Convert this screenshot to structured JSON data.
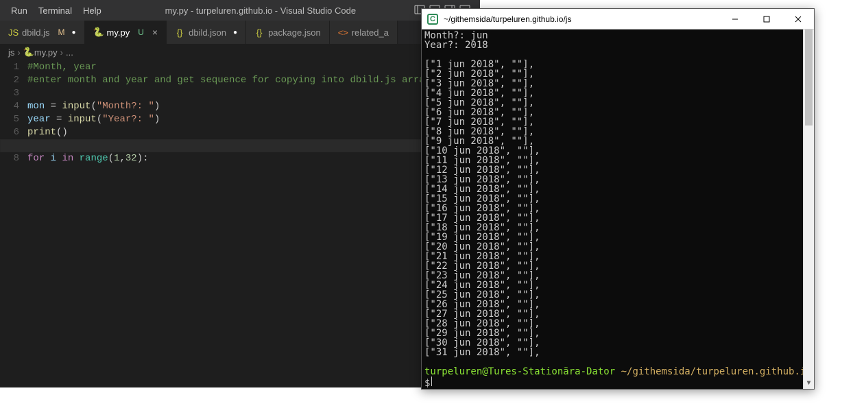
{
  "vscode": {
    "menu": {
      "run": "Run",
      "terminal": "Terminal",
      "help": "Help"
    },
    "window_title": "my.py - turpeluren.github.io - Visual Studio Code",
    "tabs": [
      {
        "icon": "JS",
        "icon_color": "#cbcb41",
        "label": "dbild.js",
        "status": "M",
        "modified": true,
        "active": false
      },
      {
        "icon": "🐍",
        "icon_color": "#3572A5",
        "label": "my.py",
        "status": "U",
        "modified": false,
        "active": true
      },
      {
        "icon": "{}",
        "icon_color": "#cbcb41",
        "label": "dbild.json",
        "status": "",
        "modified": true,
        "active": false
      },
      {
        "icon": "{}",
        "icon_color": "#cbcb41",
        "label": "package.json",
        "status": "",
        "modified": false,
        "active": false
      },
      {
        "icon": "<>",
        "icon_color": "#e37933",
        "label": "related_a",
        "status": "",
        "modified": false,
        "active": false
      }
    ],
    "breadcrumb": {
      "root": "js",
      "file": "my.py",
      "more": "..."
    },
    "code_lines": [
      {
        "n": 1,
        "segs": [
          {
            "t": "#Month, year",
            "c": "c-comment"
          }
        ]
      },
      {
        "n": 2,
        "segs": [
          {
            "t": "#enter month and year and get sequence for copying into dbild.js array",
            "c": "c-comment"
          }
        ]
      },
      {
        "n": 3,
        "segs": []
      },
      {
        "n": 4,
        "segs": [
          {
            "t": "mon",
            "c": "c-var"
          },
          {
            "t": " = ",
            "c": "c-punc"
          },
          {
            "t": "input",
            "c": "c-func"
          },
          {
            "t": "(",
            "c": "c-punc"
          },
          {
            "t": "\"Month?: \"",
            "c": "c-str"
          },
          {
            "t": ")",
            "c": "c-punc"
          }
        ]
      },
      {
        "n": 5,
        "segs": [
          {
            "t": "year",
            "c": "c-var"
          },
          {
            "t": " = ",
            "c": "c-punc"
          },
          {
            "t": "input",
            "c": "c-func"
          },
          {
            "t": "(",
            "c": "c-punc"
          },
          {
            "t": "\"Year?: \"",
            "c": "c-str"
          },
          {
            "t": ")",
            "c": "c-punc"
          }
        ]
      },
      {
        "n": 6,
        "segs": [
          {
            "t": "print",
            "c": "c-func"
          },
          {
            "t": "()",
            "c": "c-punc"
          }
        ]
      },
      {
        "n": 7,
        "segs": [],
        "cursor": true
      },
      {
        "n": 8,
        "segs": [
          {
            "t": "for",
            "c": "c-kw"
          },
          {
            "t": " ",
            "c": "c-punc"
          },
          {
            "t": "i",
            "c": "c-var"
          },
          {
            "t": " ",
            "c": "c-punc"
          },
          {
            "t": "in",
            "c": "c-kw"
          },
          {
            "t": " ",
            "c": "c-punc"
          },
          {
            "t": "range",
            "c": "c-builtin"
          },
          {
            "t": "(",
            "c": "c-punc"
          },
          {
            "t": "1",
            "c": "c-num"
          },
          {
            "t": ",",
            "c": "c-punc"
          },
          {
            "t": "32",
            "c": "c-num"
          },
          {
            "t": "):",
            "c": "c-punc"
          }
        ]
      }
    ]
  },
  "cmd": {
    "title": "~/githemsida/turpeluren.github.io/js",
    "input_lines": [
      "Month?: jun",
      "Year?: 2018",
      ""
    ],
    "output": [
      "[\"1 jun 2018\", \"\"],",
      "[\"2 jun 2018\", \"\"],",
      "[\"3 jun 2018\", \"\"],",
      "[\"4 jun 2018\", \"\"],",
      "[\"5 jun 2018\", \"\"],",
      "[\"6 jun 2018\", \"\"],",
      "[\"7 jun 2018\", \"\"],",
      "[\"8 jun 2018\", \"\"],",
      "[\"9 jun 2018\", \"\"],",
      "[\"10 jun 2018\", \"\"],",
      "[\"11 jun 2018\", \"\"],",
      "[\"12 jun 2018\", \"\"],",
      "[\"13 jun 2018\", \"\"],",
      "[\"14 jun 2018\", \"\"],",
      "[\"15 jun 2018\", \"\"],",
      "[\"16 jun 2018\", \"\"],",
      "[\"17 jun 2018\", \"\"],",
      "[\"18 jun 2018\", \"\"],",
      "[\"19 jun 2018\", \"\"],",
      "[\"20 jun 2018\", \"\"],",
      "[\"21 jun 2018\", \"\"],",
      "[\"22 jun 2018\", \"\"],",
      "[\"23 jun 2018\", \"\"],",
      "[\"24 jun 2018\", \"\"],",
      "[\"25 jun 2018\", \"\"],",
      "[\"26 jun 2018\", \"\"],",
      "[\"27 jun 2018\", \"\"],",
      "[\"28 jun 2018\", \"\"],",
      "[\"29 jun 2018\", \"\"],",
      "[\"30 jun 2018\", \"\"],",
      "[\"31 jun 2018\", \"\"],"
    ],
    "prompt": {
      "user": "turpeluren@Tures-Stationära-Dator",
      "path": "~/githemsida/turpeluren.github.io/js",
      "dollar": "$"
    }
  }
}
